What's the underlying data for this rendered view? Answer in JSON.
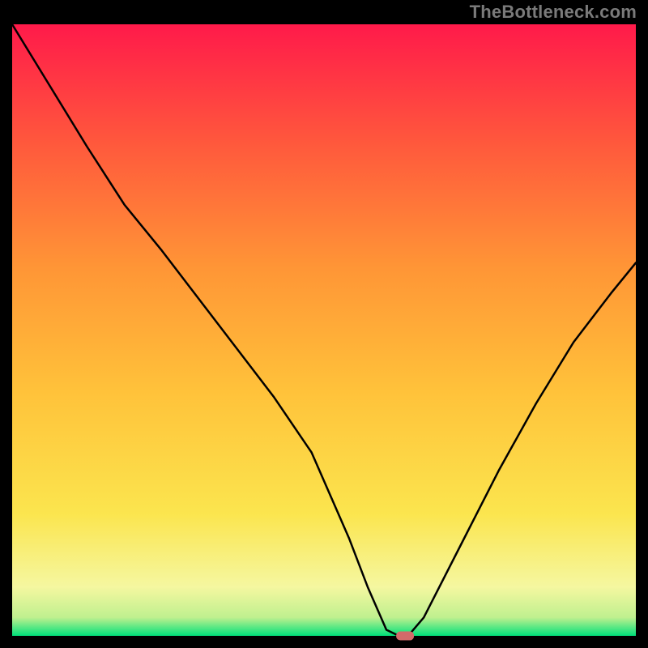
{
  "watermark": "TheBottleneck.com",
  "chart_data": {
    "type": "line",
    "title": "",
    "xlabel": "",
    "ylabel": "",
    "xlim": [
      0,
      100
    ],
    "ylim": [
      0,
      100
    ],
    "note": "0 = bottom (green band), 100 = top (red). Curve is bottleneck percentage vs x. Visually estimated from figure.",
    "series": [
      {
        "name": "bottleneck-curve",
        "x": [
          0,
          6,
          12,
          18,
          24,
          30,
          36,
          42,
          48,
          54,
          57,
          60,
          62,
          63.5,
          66,
          72,
          78,
          84,
          90,
          96,
          100
        ],
        "values": [
          100,
          90,
          80,
          70.5,
          63,
          55,
          47,
          39,
          30,
          16,
          8,
          1,
          0,
          0,
          3,
          15,
          27,
          38,
          48,
          56,
          61
        ]
      }
    ],
    "marker": {
      "x": 63,
      "y": 0,
      "color": "#d36a6a"
    },
    "bands": {
      "green_top": 4.5,
      "yellow_top": 15
    },
    "frame_color": "#000000",
    "gradient_stops": [
      {
        "offset": 0,
        "color": "#00e07a"
      },
      {
        "offset": 3,
        "color": "#bff08f"
      },
      {
        "offset": 8,
        "color": "#f5f7a0"
      },
      {
        "offset": 20,
        "color": "#fbe54e"
      },
      {
        "offset": 40,
        "color": "#ffc23a"
      },
      {
        "offset": 60,
        "color": "#ff9636"
      },
      {
        "offset": 80,
        "color": "#ff5a3c"
      },
      {
        "offset": 100,
        "color": "#ff1a4a"
      }
    ]
  }
}
